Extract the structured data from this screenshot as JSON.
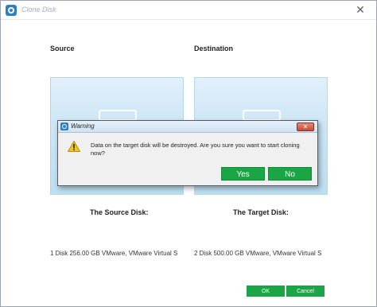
{
  "window": {
    "title": "Clone Disk",
    "close_glyph": "✕"
  },
  "labels": {
    "source": "Source",
    "destination": "Destination"
  },
  "source_disk": {
    "title": "The Source Disk:",
    "info": "1 Disk 256.00 GB VMware,  VMware Virtual S"
  },
  "target_disk": {
    "title": "The Target Disk:",
    "info": "2 Disk 500.00 GB VMware,  VMware Virtual S"
  },
  "footer": {
    "ok_label": "OK",
    "cancel_label": "Cancel"
  },
  "dialog": {
    "title": "Warning",
    "close_glyph": "✕",
    "message": "Data on the target disk will be destroyed. Are you sure you want to start cloning now?",
    "yes_label": "Yes",
    "no_label": "No",
    "icon": "warning-icon"
  },
  "colors": {
    "accent_green": "#1aa645",
    "panel_blue": "#cde6f6",
    "app_icon_blue": "#2e7fc4"
  }
}
